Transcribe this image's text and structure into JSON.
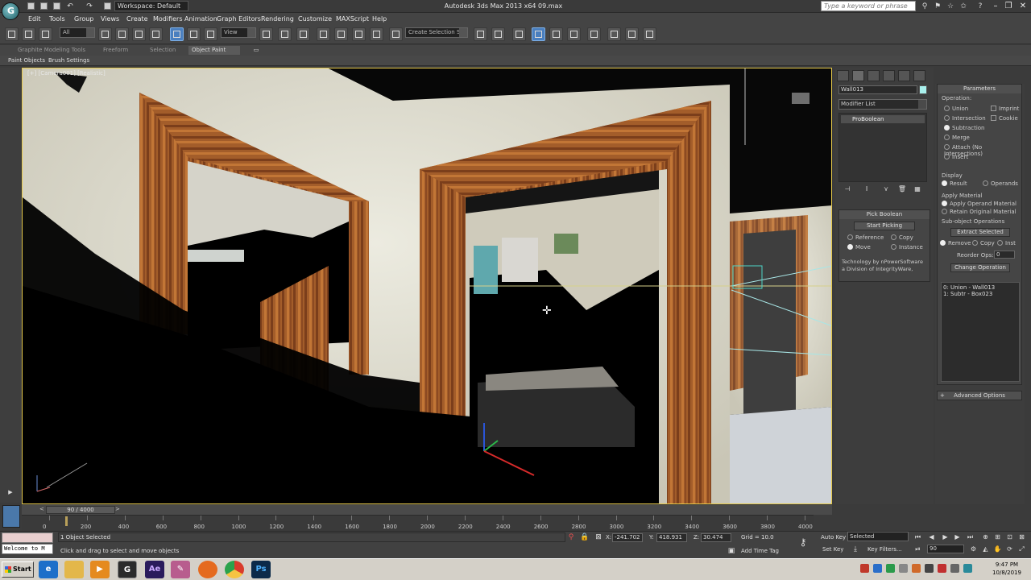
{
  "title_bar": {
    "workspace": "Workspace: Default",
    "title": "Autodesk 3ds Max  2013 x64      09.max",
    "search_placeholder": "Type a keyword or phrase"
  },
  "menu": [
    "Edit",
    "Tools",
    "Group",
    "Views",
    "Create",
    "Modifiers",
    "Animation",
    "Graph Editors",
    "Rendering",
    "Customize",
    "MAXScript",
    "Help"
  ],
  "toolbar": {
    "selection_filter": "All",
    "reference_coord": "View",
    "named_selection": "Create Selection Se"
  },
  "ribbon": {
    "tabs": [
      "Graphite Modeling Tools",
      "Freeform",
      "Selection",
      "Object Paint"
    ],
    "active_tab": "Object Paint",
    "sub_items": [
      "Paint Objects",
      "Brush Settings"
    ]
  },
  "viewport": {
    "label": "[+] [Camera001] [Realistic]"
  },
  "command_panel": {
    "object_name": "Wall013",
    "object_color": "#a8f0ec",
    "modifier_list": "Modifier List",
    "stack_item": "ProBoolean",
    "pick_boolean": {
      "title": "Pick Boolean",
      "start_picking": "Start Picking",
      "reference": "Reference",
      "copy": "Copy",
      "move": "Move",
      "instance": "Instance",
      "credit_line1": "Technology by nPowerSoftware",
      "credit_line2": "a Division of IntegrityWare,"
    }
  },
  "parameters": {
    "title": "Parameters",
    "operation_label": "Operation:",
    "operations": [
      "Union",
      "Intersection",
      "Subtraction",
      "Merge",
      "Attach (No Intersections)",
      "Insert"
    ],
    "selected_operation": "Subtraction",
    "imprint": "Imprint",
    "cookie": "Cookie",
    "display_label": "Display",
    "display_result": "Result",
    "display_operands": "Operands",
    "apply_material_label": "Apply Material",
    "apply_operand_material": "Apply Operand Material",
    "retain_original_material": "Retain Original Material",
    "subobject_label": "Sub-object Operations",
    "extract_selected": "Extract Selected",
    "remove": "Remove",
    "copy": "Copy",
    "inst": "Inst",
    "reorder_ops": "Reorder Ops:",
    "reorder_value": "0",
    "change_operation": "Change Operation",
    "op_list": [
      "0: Union - Wall013",
      "1: Subtr - Box023"
    ],
    "advanced_options": "Advanced Options"
  },
  "timeline": {
    "frame_indicator": "90 / 4000",
    "ticks": [
      "0",
      "200",
      "400",
      "600",
      "800",
      "1000",
      "1200",
      "1400",
      "1600",
      "1800",
      "2000",
      "2200",
      "2400",
      "2600",
      "2800",
      "3000",
      "3200",
      "3400",
      "3600",
      "3800",
      "4000"
    ],
    "current_frame": 90,
    "total_frames": 4000
  },
  "status": {
    "maxscript_text": "Welcome to M",
    "selection_info": "1 Object Selected",
    "prompt": "Click and drag to select and move objects",
    "x_label": "X:",
    "x_value": "-241.702",
    "y_label": "Y:",
    "y_value": "418.931",
    "z_label": "Z:",
    "z_value": "30.474",
    "grid": "Grid = 10.0",
    "add_time_tag": "Add Time Tag",
    "auto_key": "Auto Key",
    "set_key": "Set Key",
    "selected_dd": "Selected",
    "key_filters": "Key Filters...",
    "frame_value": "90"
  },
  "taskbar": {
    "start": "Start",
    "apps": [
      "ie-icon",
      "folder-icon",
      "media-icon",
      "3dsmax-icon",
      "aftereffects-icon",
      "word-icon",
      "firefox-icon",
      "chrome-icon",
      "photoshop-icon"
    ],
    "ae_label": "Ae",
    "ps_label": "Ps",
    "clock_time": "9:47 PM",
    "clock_date": "10/8/2019"
  }
}
